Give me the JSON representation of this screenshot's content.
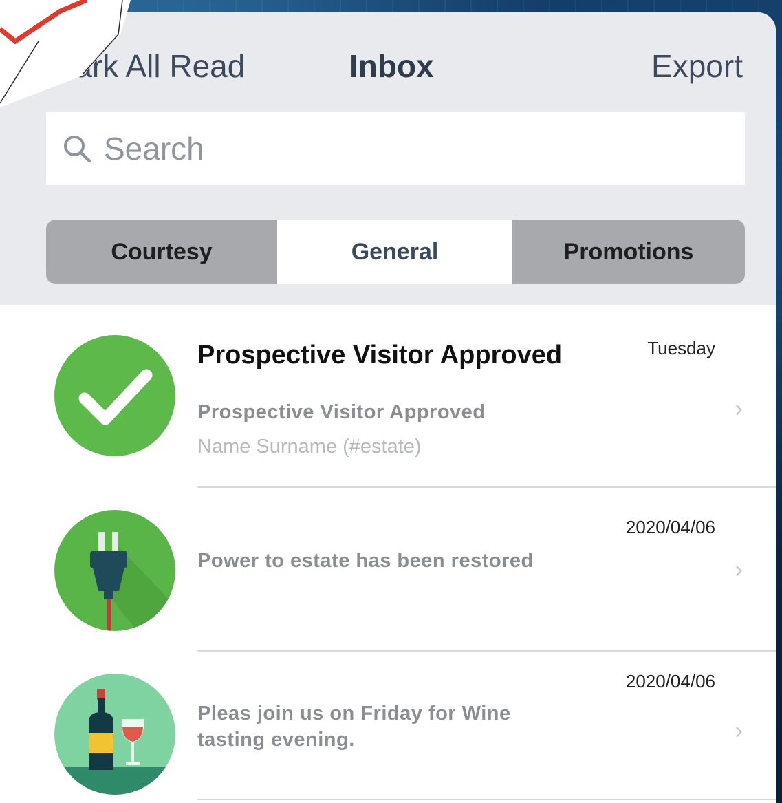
{
  "nav": {
    "left_label": "Mark All Read",
    "title": "Inbox",
    "right_label": "Export"
  },
  "search": {
    "placeholder": "Search"
  },
  "segments": [
    {
      "label": "Courtesy",
      "active": false
    },
    {
      "label": "General",
      "active": true
    },
    {
      "label": "Promotions",
      "active": false
    }
  ],
  "messages": [
    {
      "title": "Prospective Visitor Approved",
      "line1": "Prospective Visitor Approved",
      "line2": "Name Surname (#estate)",
      "date": "Tuesday",
      "icon": "checkmark-icon"
    },
    {
      "line1": "Power to estate has been restored",
      "date": "2020/04/06",
      "icon": "power-plug-icon"
    },
    {
      "line1a": "Pleas join us on Friday for Wine",
      "line1b": "tasting evening.",
      "date": "2020/04/06",
      "icon": "wine-icon"
    }
  ],
  "colors": {
    "green": "#5cb94a",
    "segment_bg": "#a7a9ac",
    "header_bg": "#e8eaed"
  }
}
